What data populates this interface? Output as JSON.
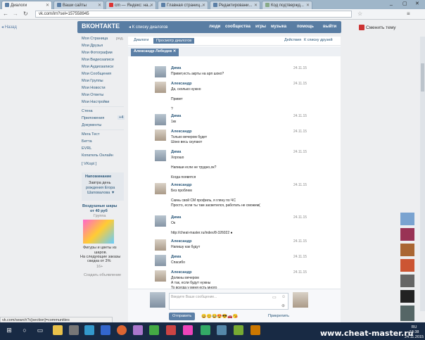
{
  "browser": {
    "tabs": [
      {
        "label": "Диалоги"
      },
      {
        "label": "Ваши сайты"
      },
      {
        "label": "cm — Яндекс: на..."
      },
      {
        "label": "Главная страниц..."
      },
      {
        "label": "Редактировани..."
      },
      {
        "label": "Код подтвержд..."
      }
    ],
    "url": "vk.com/im?sel=157558945",
    "status_url": "vk.com/search?c[section]=communities"
  },
  "vk": {
    "back_label": "Назад",
    "logo": "ВКОНТАКТЕ",
    "back_to_dialogs": "К списку диалогов",
    "nav": [
      "люди",
      "сообщества",
      "игры",
      "музыка",
      "помощь",
      "выйти"
    ],
    "change_theme": "Сменить тему",
    "left_menu": [
      "Моя Страница",
      "Мои Друзья",
      "Мои Фотографии",
      "Мои Видеозаписи",
      "Мои Аудиозаписи",
      "Мои Сообщения",
      "Мои Группы",
      "Мои Новости",
      "Мои Ответы",
      "Мои Настройки"
    ],
    "menu_edit": "ред.",
    "left_menu2": [
      "Стена",
      "Приложения",
      "Документы"
    ],
    "apps_badge": "+4",
    "left_menu3": [
      "Мега Тест",
      "Бетта",
      "EVRL",
      "Копатель Онлайн"
    ],
    "vkopt": "[ VKopt ]",
    "reminder": {
      "title": "Напоминание",
      "text1": "Завтра день",
      "text2": "рождения Егора",
      "text3": "Шаповалова ▼"
    },
    "ad": {
      "title1": "Воздушные шары",
      "title2": "от 40 руб",
      "group": "Группа",
      "text1": "Фигуры и цветы из",
      "text2": "шаров.",
      "text3": "На следующие заказы",
      "text4": "скидка от 3%",
      "age": "16+",
      "create": "Создать объявление"
    },
    "content_tabs": [
      "Диалоги",
      "Просмотр диалогов"
    ],
    "actions": "Действия",
    "to_friends": "К списку друзей",
    "chip_name": "Александр Лебедев",
    "messages": [
      {
        "name": "Дима",
        "time": "24.11.15",
        "lines": [
          "Привет,есть акрты на арп шоко?"
        ]
      },
      {
        "name": "Александр",
        "time": "24.11.15",
        "lines": [
          "Да, сколько нужно",
          "",
          "Привет",
          "",
          "?"
        ]
      },
      {
        "name": "Дима",
        "time": "24.11.15",
        "lines": [
          "1кк"
        ]
      },
      {
        "name": "Александр",
        "time": "24.11.15",
        "lines": [
          "Только вечером будет",
          "Шоко весь скупают"
        ]
      },
      {
        "name": "Дима",
        "time": "24.11.15",
        "lines": [
          "Хорошо",
          "",
          "Напиши если не трудно,ок?",
          "",
          "Когда появятся"
        ]
      },
      {
        "name": "Александр",
        "time": "24.11.15",
        "lines": [
          "Без проблем",
          "",
          "Скинь свой CM профиль, я гляну по ЧС",
          "Просто, если ты там засветился, работать не сможем("
        ]
      },
      {
        "name": "Дима",
        "time": "24.11.15",
        "lines": [
          "Ок",
          "",
          "http://cheat-master.ru/index/8-326022 ●"
        ]
      },
      {
        "name": "Александр",
        "time": "24.11.15",
        "lines": [
          "Напишу как будут"
        ]
      },
      {
        "name": "Дима",
        "time": "24.11.15",
        "lines": [
          "Спасибо"
        ]
      },
      {
        "name": "Александр",
        "time": "24.11.15",
        "lines": [
          "Должны вечером",
          "А так, если будут нужны",
          "То всегда у меня есть много"
        ]
      }
    ],
    "compose_placeholder": "Введите Ваше сообщение...",
    "send_label": "Отправить",
    "send_to_label": "Прикрепить",
    "emoji": "😀😊😂😍😎🚗😘"
  },
  "taskbar": {
    "watermark": "www.cheat-master.ru",
    "lang": "RU",
    "time": "13:38",
    "date": "24.11.2015"
  }
}
